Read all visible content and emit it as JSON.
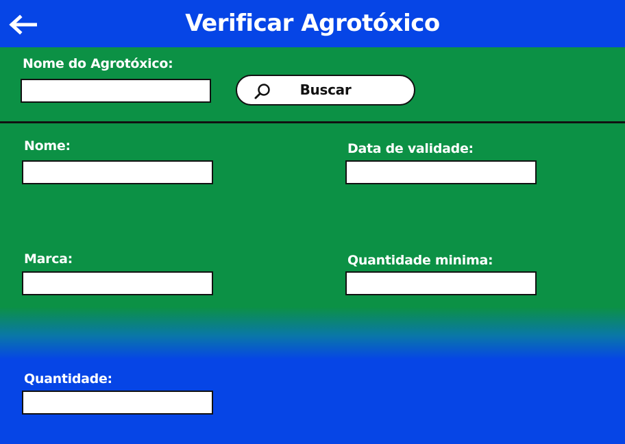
{
  "header": {
    "title": "Verificar Agrotóxico",
    "back_icon": "arrow-left-icon",
    "background_color": "#0645e6"
  },
  "search": {
    "label": "Nome do Agrotóxico:",
    "value": "",
    "button_label": "Buscar",
    "button_icon": "search-icon"
  },
  "form": {
    "nome": {
      "label": "Nome:",
      "value": ""
    },
    "data_validade": {
      "label": "Data de validade:",
      "value": ""
    },
    "marca": {
      "label": "Marca:",
      "value": ""
    },
    "quantidade_minima": {
      "label": "Quantidade minima:",
      "value": ""
    },
    "quantidade": {
      "label": "Quantidade:",
      "value": ""
    }
  },
  "colors": {
    "green": "#0c9145",
    "blue": "#0645e6",
    "text": "#ffffff"
  }
}
